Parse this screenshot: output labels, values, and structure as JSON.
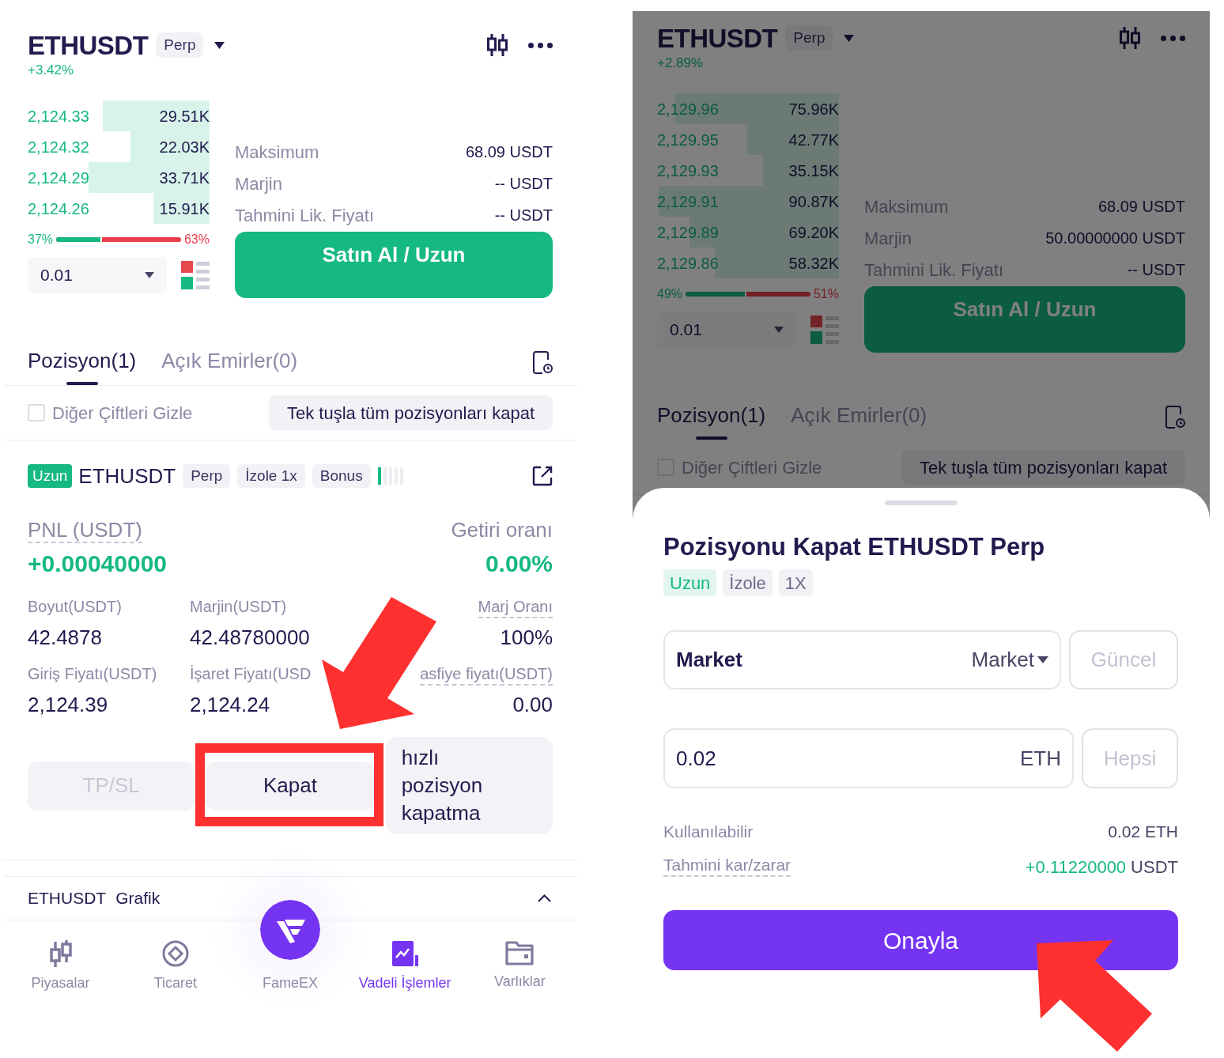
{
  "left_screen": {
    "header": {
      "symbol": "ETHUSDT",
      "badge": "Perp",
      "change": "+3.42%"
    },
    "order_book": [
      {
        "price": "2,124.33",
        "amount": "29.51K",
        "level": 0.59
      },
      {
        "price": "2,124.32",
        "amount": "22.03K",
        "level": 0.44
      },
      {
        "price": "2,124.29",
        "amount": "33.71K",
        "level": 0.67
      },
      {
        "price": "2,124.26",
        "amount": "15.91K",
        "level": 0.31
      }
    ],
    "ratio": {
      "buy": "37%",
      "sell": "63%",
      "level": 0.37
    },
    "quantity": "0.01",
    "info": [
      {
        "label": "Maksimum",
        "value": "68.09 USDT"
      },
      {
        "label": "Marjin",
        "value": "-- USDT"
      },
      {
        "label": "Tahmini Lik. Fiyatı",
        "value": "-- USDT"
      }
    ],
    "buy_button": "Satın Al / Uzun",
    "tabs": [
      {
        "label": "Pozisyon(1)",
        "selected": true
      },
      {
        "label": "Açık Emirler(0)",
        "selected": false
      }
    ],
    "hide_pairs": {
      "label": "Diğer Çiftleri Gizle",
      "checked": false
    },
    "close_all_button": "Tek tuşla tüm pozisyonları kapat",
    "position": {
      "side": "Uzun",
      "symbol": "ETHUSDT",
      "tags": [
        "Perp",
        "İzole 1x",
        "Bonus"
      ],
      "risk": {
        "level": 0.2
      },
      "summary": [
        {
          "label": "PNL (USDT)",
          "value": "+0.00040000",
          "dashed": true
        },
        {
          "label": "Getiri oranı",
          "value": "0.00%",
          "dashed": false
        }
      ],
      "stats": [
        {
          "label": "Boyut(USDT)",
          "value": "42.4878",
          "dashed": false
        },
        {
          "label": "Marjin(USDT)",
          "value": "42.48780000",
          "dashed": false
        },
        {
          "label": "Marj Oranı",
          "value": "100%",
          "dashed": true
        },
        {
          "label": "Giriş Fiyatı(USDT)",
          "value": "2,124.39",
          "dashed": false
        },
        {
          "label": "İşaret Fiyatı(USD",
          "value": "2,124.24",
          "dashed": false
        },
        {
          "label": "asfiye fiyatı(USDT)",
          "value": "0.00",
          "dashed": true
        }
      ],
      "actions": [
        {
          "label": "TP/SL",
          "disabled": true,
          "highlighted": false,
          "arrow": false
        },
        {
          "label": "Kapat",
          "disabled": false,
          "highlighted": true,
          "arrow": true
        },
        {
          "label": "hızlı pozisyon kapatma",
          "disabled": false,
          "highlighted": false,
          "arrow": false
        }
      ]
    },
    "chart_section": {
      "symbol": "ETHUSDT",
      "label": "Grafik"
    },
    "bottom_nav": [
      {
        "label": "Piyasalar",
        "kind": "candles",
        "selected": false
      },
      {
        "label": "Ticaret",
        "kind": "trade",
        "selected": false
      },
      {
        "label": "FameEX",
        "kind": "logo",
        "selected": false
      },
      {
        "label": "Vadeli İşlemler",
        "kind": "futures",
        "selected": true
      },
      {
        "label": "Varlıklar",
        "kind": "wallet",
        "selected": false
      }
    ]
  },
  "right_screen": {
    "dimmed": true,
    "header": {
      "symbol": "ETHUSDT",
      "badge": "Perp",
      "change": "+2.89%"
    },
    "order_book": [
      {
        "price": "2,129.96",
        "amount": "75.96K",
        "level": 0.91
      },
      {
        "price": "2,129.95",
        "amount": "42.77K",
        "level": 0.51
      },
      {
        "price": "2,129.93",
        "amount": "35.15K",
        "level": 0.42
      },
      {
        "price": "2,129.91",
        "amount": "90.87K",
        "level": 1
      },
      {
        "price": "2,129.89",
        "amount": "69.20K",
        "level": 0.83
      },
      {
        "price": "2,129.86",
        "amount": "58.32K",
        "level": 0.69
      }
    ],
    "ratio": {
      "buy": "49%",
      "sell": "51%",
      "level": 0.49
    },
    "quantity": "0.01",
    "info": [
      {
        "label": "Maksimum",
        "value": "68.09 USDT"
      },
      {
        "label": "Marjin",
        "value": "50.00000000 USDT"
      },
      {
        "label": "Tahmini Lik. Fiyatı",
        "value": "-- USDT"
      }
    ],
    "buy_button": "Satın Al / Uzun",
    "tabs": [
      {
        "label": "Pozisyon(1)",
        "selected": true
      },
      {
        "label": "Açık Emirler(0)",
        "selected": false
      }
    ],
    "hide_pairs": {
      "label": "Diğer Çiftleri Gizle",
      "checked": false
    },
    "close_all_button": "Tek tuşla tüm pozisyonları kapat",
    "sheet": {
      "title": "Pozisyonu Kapat ETHUSDT Perp",
      "tags": [
        {
          "label": "Uzun",
          "kind": "side"
        },
        {
          "label": "İzole",
          "kind": "plain"
        },
        {
          "label": "1X",
          "kind": "plain"
        }
      ],
      "price_field": {
        "value": "Market",
        "type": "Market"
      },
      "update_button": "Güncel",
      "amount_field": {
        "value": "0.02",
        "unit": "ETH"
      },
      "all_button": "Hepsi",
      "available": {
        "label": "Kullanılabilir",
        "value": "0.02 ETH"
      },
      "estimate": {
        "label": "Tahmini kar/zarar",
        "value": "+0.11220000",
        "unit": "USDT"
      },
      "confirm_button": {
        "label": "Onayla",
        "arrow": true
      }
    }
  }
}
